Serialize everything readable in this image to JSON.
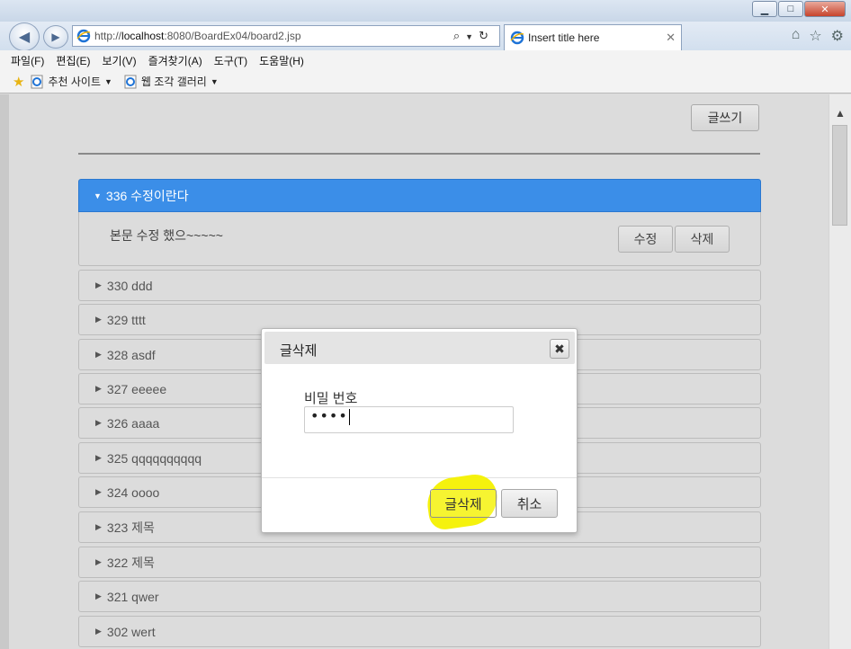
{
  "browser": {
    "address_protocol": "http://",
    "address_host": "localhost",
    "address_rest": ":8080/BoardEx04/board2.jsp",
    "tab_title": "Insert title here",
    "menu": [
      "파일(F)",
      "편집(E)",
      "보기(V)",
      "즐겨찾기(A)",
      "도구(T)",
      "도움말(H)"
    ],
    "favorites": [
      "추천 사이트",
      "웹 조각 갤러리"
    ]
  },
  "page": {
    "write_button": "글쓰기",
    "open_post": {
      "title": "336 수정이란다",
      "body": "본문 수정 했으~~~~~",
      "edit_button": "수정",
      "delete_button": "삭제"
    },
    "posts": [
      "330 ddd",
      "329 tttt",
      "328 asdf",
      "327 eeeee",
      "326 aaaa",
      "325 qqqqqqqqqq",
      "324 oooo",
      "323 제목",
      "322 제목",
      "321 qwer",
      "302 wert"
    ]
  },
  "modal": {
    "title": "글삭제",
    "close_glyph": "✖",
    "password_label": "비밀 번호",
    "password_value": "••••",
    "delete_button": "글삭제",
    "cancel_button": "취소"
  },
  "colors": {
    "accent": "#3b8ee8",
    "highlight": "#f4f100"
  }
}
